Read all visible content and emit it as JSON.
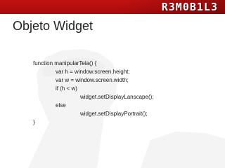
{
  "header": {
    "logo_text": "R3M0B1L3",
    "bar_color": "#b50f0f"
  },
  "slide": {
    "title": "Objeto Widget",
    "watermark_icon": "raised-fist-icon",
    "code_lines": [
      "function manipularTela() {",
      "var h = window.screen.height;",
      "var w = window.screen.width;",
      "if (h < w)",
      "widget.setDisplayLanscape();",
      "else",
      "widget.setDisplayPortrait();",
      "}"
    ]
  }
}
